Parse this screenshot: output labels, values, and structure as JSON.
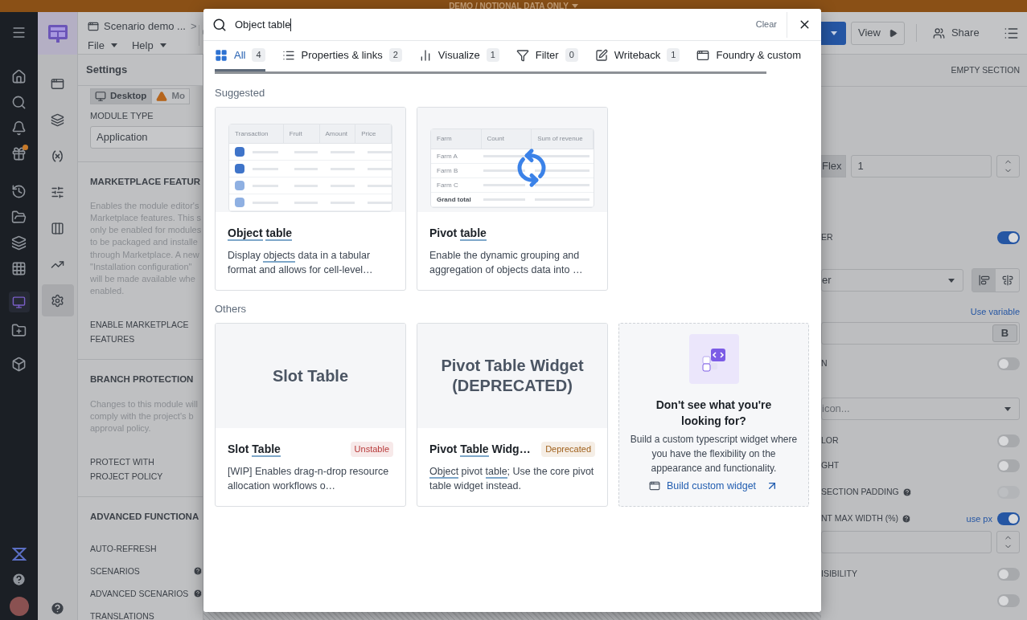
{
  "banner": {
    "text": "DEMO / NOTIONAL DATA ONLY"
  },
  "header": {
    "breadcrumb": "Scenario demo ...",
    "separator": ">",
    "menus": [
      "File",
      "Help"
    ],
    "view_button": "View",
    "share_button": "Share"
  },
  "icon_rail": [
    {
      "selected": false
    },
    {
      "selected": false
    },
    {
      "selected": false
    },
    {
      "selected": false
    },
    {
      "selected": false
    },
    {
      "selected": false
    },
    {
      "selected": true
    }
  ],
  "settings": {
    "title": "Settings",
    "device_tabs": [
      {
        "label": "Desktop",
        "selected": true
      },
      {
        "label": "Mo",
        "selected": false
      }
    ],
    "module_type": {
      "label": "MODULE TYPE",
      "value": "Application"
    },
    "sections": [
      {
        "heading": "MARKETPLACE FEATUR",
        "description": [
          "Enables the module editor's",
          "Marketplace features. This s",
          "only be enabled for modules",
          "to be packaged and installe",
          "through Marketplace. A new",
          "\"Installation configuration\"",
          "will be made available whe",
          "enabled."
        ],
        "fields": [
          {
            "label": "ENABLE MARKETPLACE FEATURES"
          }
        ]
      },
      {
        "heading": "BRANCH PROTECTION",
        "description": [
          "Changes to this module will",
          "comply with the project's b",
          "approval policy."
        ],
        "fields": [
          {
            "label": "PROTECT WITH PROJECT POLICY"
          }
        ]
      },
      {
        "heading": "ADVANCED FUNCTIONA",
        "fields": [
          {
            "label": "AUTO-REFRESH"
          },
          {
            "label": "SCENARIOS",
            "help": true
          },
          {
            "label": "ADVANCED SCENARIOS",
            "help": true
          },
          {
            "label": "TRANSLATIONS"
          }
        ]
      }
    ]
  },
  "right_panel": {
    "header": "EMPTY SECTION",
    "rows": [
      {
        "kind": "flex_input",
        "segment": "Flex",
        "value": "1"
      },
      {
        "kind": "toggle",
        "label": "ER",
        "on": true
      },
      {
        "kind": "select_align",
        "value": "er",
        "align": [
          {
            "selected": true
          },
          {
            "selected": false
          }
        ]
      },
      {
        "kind": "link",
        "label": "Use variable"
      },
      {
        "kind": "input_bold",
        "button": "B"
      },
      {
        "kind": "toggle",
        "label": "N",
        "on": false
      },
      {
        "kind": "select",
        "placeholder": "icon..."
      },
      {
        "kind": "toggle",
        "label": "LOR",
        "on": false
      },
      {
        "kind": "toggle",
        "label": "GHT",
        "on": false
      },
      {
        "kind": "toggle",
        "label": "SECTION PADDING",
        "on": false,
        "help": true,
        "disabled": true
      },
      {
        "kind": "toggle",
        "label": "NT MAX WIDTH (%)",
        "on": true,
        "help": true,
        "link": "use px"
      },
      {
        "kind": "stepper"
      },
      {
        "kind": "toggle",
        "label": "ISIBILITY",
        "on": false
      },
      {
        "kind": "toggle",
        "on": false
      }
    ]
  },
  "dialog": {
    "search": {
      "value": "Object table"
    },
    "clear": "Clear",
    "tabs": [
      {
        "label": "All",
        "count": "4",
        "selected": true
      },
      {
        "label": "Properties & links",
        "count": "2",
        "selected": false
      },
      {
        "label": "Visualize",
        "count": "1",
        "selected": false
      },
      {
        "label": "Filter",
        "count": "0",
        "selected": false
      },
      {
        "label": "Writeback",
        "count": "1",
        "selected": false
      },
      {
        "label": "Foundry & custom",
        "selected": false
      }
    ],
    "groups": [
      {
        "title": "Suggested",
        "cards": [
          {
            "kind": "widget",
            "preview": {
              "kind": "object_table",
              "columns": [
                "Transaction",
                "Fruit",
                "Amount",
                "Price"
              ]
            },
            "title": [
              {
                "text": "Object",
                "match": true
              },
              {
                "text": "table",
                "match": true
              }
            ],
            "description": [
              {
                "text": "Display ",
                "match": false
              },
              {
                "text": "objects",
                "match": true
              },
              {
                "text": " data in a tabular format and allows for cell-level…",
                "match": false
              }
            ]
          },
          {
            "kind": "widget",
            "preview": {
              "kind": "pivot_table",
              "columns": [
                "Farm",
                "Count",
                "Sum of revenue"
              ],
              "rows": [
                "Farm A",
                "Farm B",
                "Farm C",
                "Grand total"
              ]
            },
            "title": [
              {
                "text": "Pivot ",
                "match": false
              },
              {
                "text": "table",
                "match": true
              }
            ],
            "description": [
              {
                "text": "Enable the dynamic grouping and aggregation of objects data into …",
                "match": false
              }
            ]
          }
        ]
      },
      {
        "title": "Others",
        "cards": [
          {
            "kind": "widget",
            "preview": {
              "kind": "text",
              "text": "Slot Table"
            },
            "title": [
              {
                "text": "Slot ",
                "match": false
              },
              {
                "text": "Table",
                "match": true
              }
            ],
            "badge": {
              "label": "Unstable",
              "color": "#b83a3a"
            },
            "description": [
              {
                "text": "[WIP] Enables drag-n-drop resource allocation workflows o…",
                "match": false
              }
            ]
          },
          {
            "kind": "widget",
            "preview": {
              "kind": "text",
              "text": "Pivot Table Widget (DEPRECATED)"
            },
            "title": [
              {
                "text": "Pivot ",
                "match": false
              },
              {
                "text": "Table",
                "match": true
              },
              {
                "text": " Widg…",
                "match": false
              }
            ],
            "badge": {
              "label": "Deprecated",
              "color": "#a0611c"
            },
            "description": [
              {
                "text": "Object",
                "match": true
              },
              {
                "text": " pivot ",
                "match": false
              },
              {
                "text": "table",
                "match": true
              },
              {
                "text": "; Use the core pivot table widget instead.",
                "match": false
              }
            ]
          },
          {
            "kind": "custom",
            "title": "Don't see what you're looking for?",
            "text": "Build a custom typescript widget where you have the flexibility on the appearance and functionality.",
            "link": "Build custom widget"
          }
        ]
      }
    ]
  }
}
